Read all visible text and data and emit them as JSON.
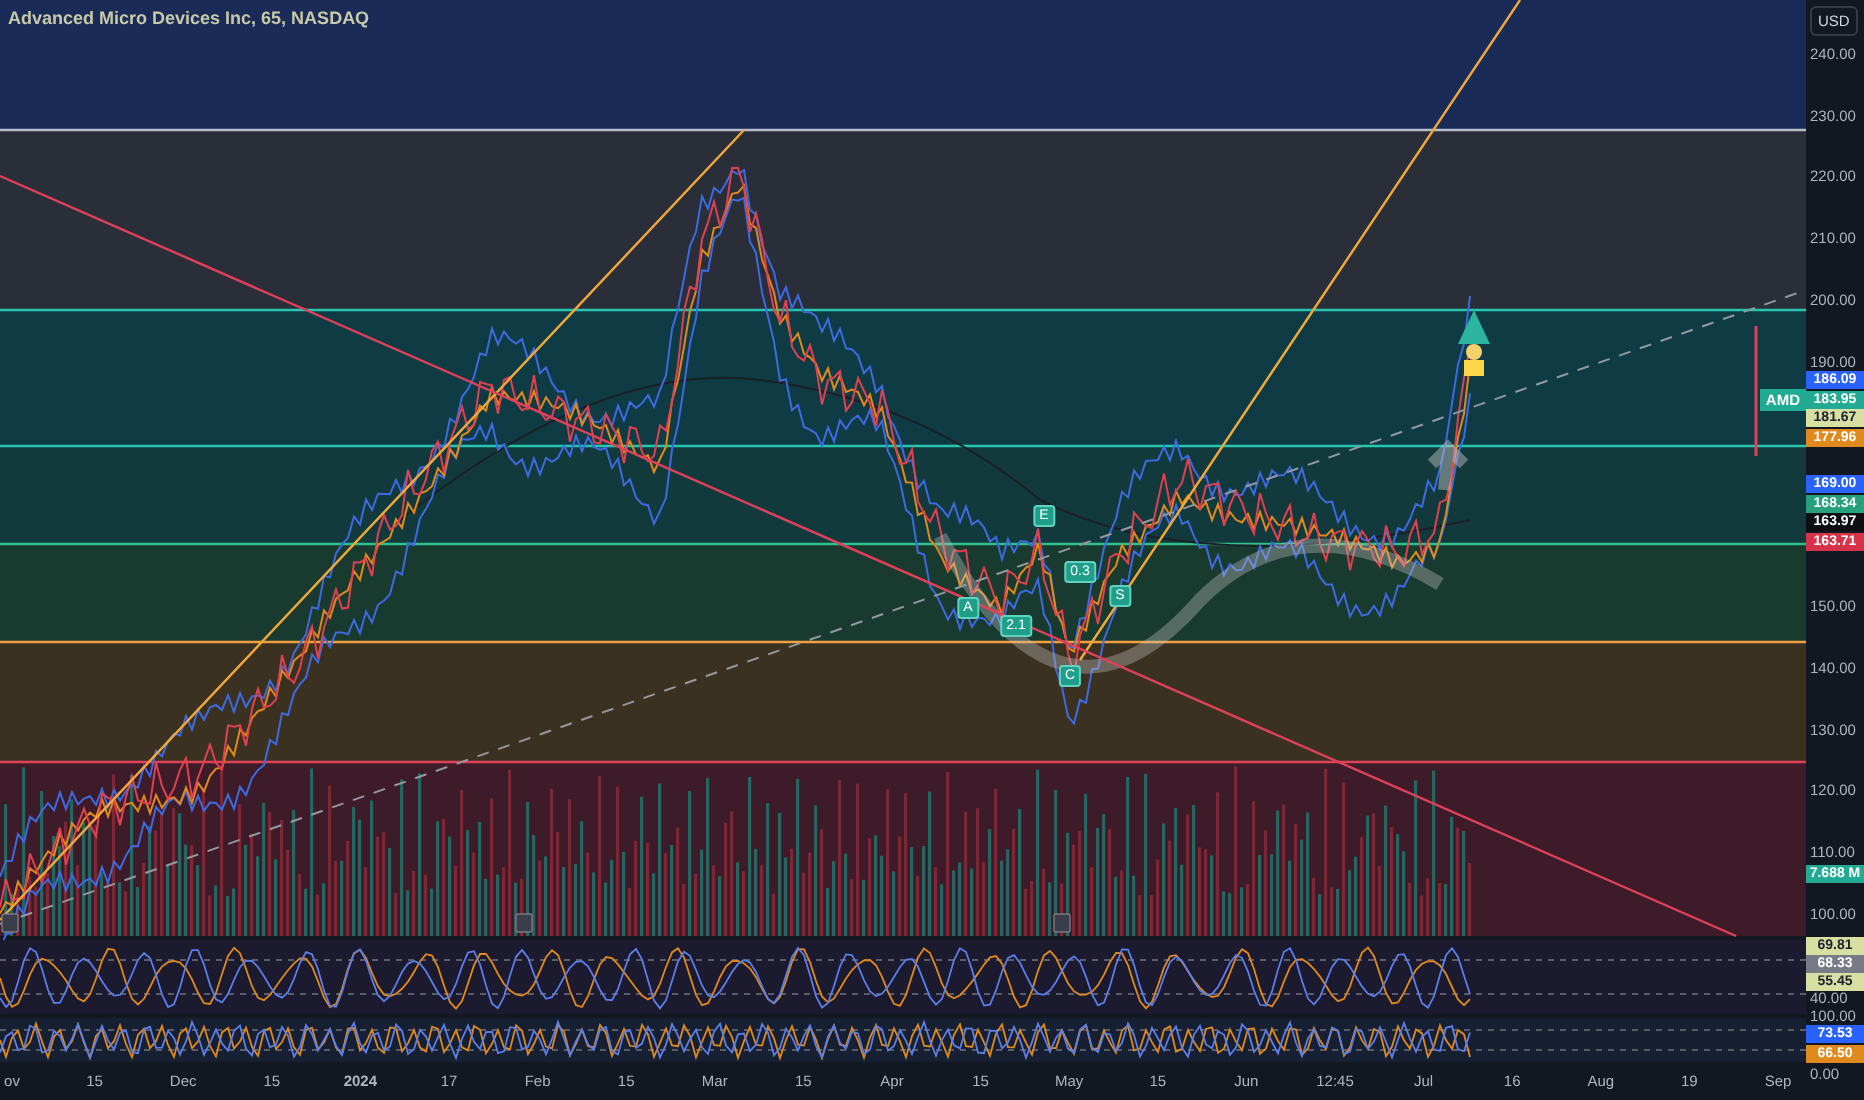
{
  "title": "Advanced Micro Devices Inc, 65, NASDAQ",
  "currency": "USD",
  "price_axis": [
    "240.00",
    "230.00",
    "220.00",
    "210.00",
    "200.00",
    "190.00",
    "150.00",
    "140.00",
    "130.00",
    "120.00",
    "110.00",
    "100.00"
  ],
  "price_tags": [
    {
      "text": "186.09",
      "color": "#2962ff"
    },
    {
      "text": "183.95",
      "color": "#22ab94"
    },
    {
      "text": "181.67",
      "color": "#d7dfa2"
    },
    {
      "text": "177.96",
      "color": "#e08a1e"
    },
    {
      "text": "169.00",
      "color": "#2962ff"
    },
    {
      "text": "168.34",
      "color": "#26a17b"
    },
    {
      "text": "163.97",
      "color": "#0d0f14"
    },
    {
      "text": "163.71",
      "color": "#d6334a"
    }
  ],
  "symbol_tag": "AMD",
  "volume_tag": {
    "text": "7.688 M",
    "color": "#22ab94"
  },
  "pattern_labels": [
    "E",
    "A",
    "2.1",
    "0.3",
    "S",
    "C"
  ],
  "oscillator_1": {
    "axis": [
      "40.00"
    ],
    "tags": [
      {
        "text": "69.81",
        "color": "#d7dfa2"
      },
      {
        "text": "68.33",
        "color": "#787b86"
      },
      {
        "text": "55.45",
        "color": "#d7dfa2"
      }
    ]
  },
  "oscillator_2": {
    "axis": [
      "100.00",
      "0.00"
    ],
    "tags": [
      {
        "text": "73.53",
        "color": "#2962ff"
      },
      {
        "text": "66.50",
        "color": "#e08a1e"
      }
    ]
  },
  "time_axis": [
    "ov",
    "15",
    "Dec",
    "15",
    "2024",
    "17",
    "Feb",
    "15",
    "Mar",
    "15",
    "Apr",
    "15",
    "May",
    "15",
    "Jun",
    "12:45",
    "Jul",
    "16",
    "Aug",
    "19",
    "Sep"
  ]
}
